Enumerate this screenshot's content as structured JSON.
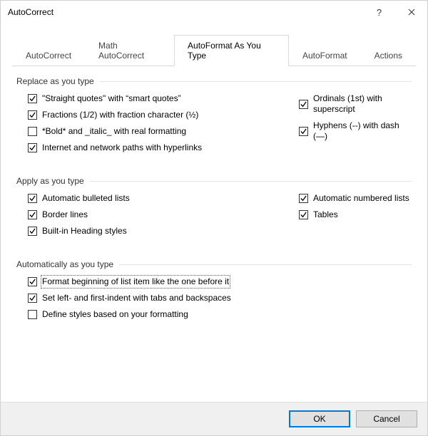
{
  "title": "AutoCorrect",
  "tabs": {
    "t0": "AutoCorrect",
    "t1": "Math AutoCorrect",
    "t2": "AutoFormat As You Type",
    "t3": "AutoFormat",
    "t4": "Actions"
  },
  "groups": {
    "replace": {
      "title": "Replace as you type",
      "items": {
        "straight_quotes": {
          "label": "\"Straight quotes\" with “smart quotes”",
          "checked": true
        },
        "fractions": {
          "label": "Fractions (1/2) with fraction character (½)",
          "checked": true
        },
        "bold_italic": {
          "label": "*Bold* and _italic_ with real formatting",
          "checked": false
        },
        "hyperlinks": {
          "label": "Internet and network paths with hyperlinks",
          "checked": true
        },
        "ordinals": {
          "label": "Ordinals (1st) with superscript",
          "checked": true
        },
        "hyphens": {
          "label": "Hyphens (--) with dash (—)",
          "checked": true
        }
      }
    },
    "apply": {
      "title": "Apply as you type",
      "items": {
        "bulleted": {
          "label": "Automatic bulleted lists",
          "checked": true
        },
        "border": {
          "label": "Border lines",
          "checked": true
        },
        "heading": {
          "label": "Built-in Heading styles",
          "checked": true
        },
        "numbered": {
          "label": "Automatic numbered lists",
          "checked": true
        },
        "tables": {
          "label": "Tables",
          "checked": true
        }
      }
    },
    "auto": {
      "title": "Automatically as you type",
      "items": {
        "format_begin": {
          "label": "Format beginning of list item like the one before it",
          "checked": true
        },
        "set_indent": {
          "label": "Set left- and first-indent with tabs and backspaces",
          "checked": true
        },
        "define_styles": {
          "label": "Define styles based on your formatting",
          "checked": false
        }
      }
    }
  },
  "buttons": {
    "ok": "OK",
    "cancel": "Cancel"
  }
}
